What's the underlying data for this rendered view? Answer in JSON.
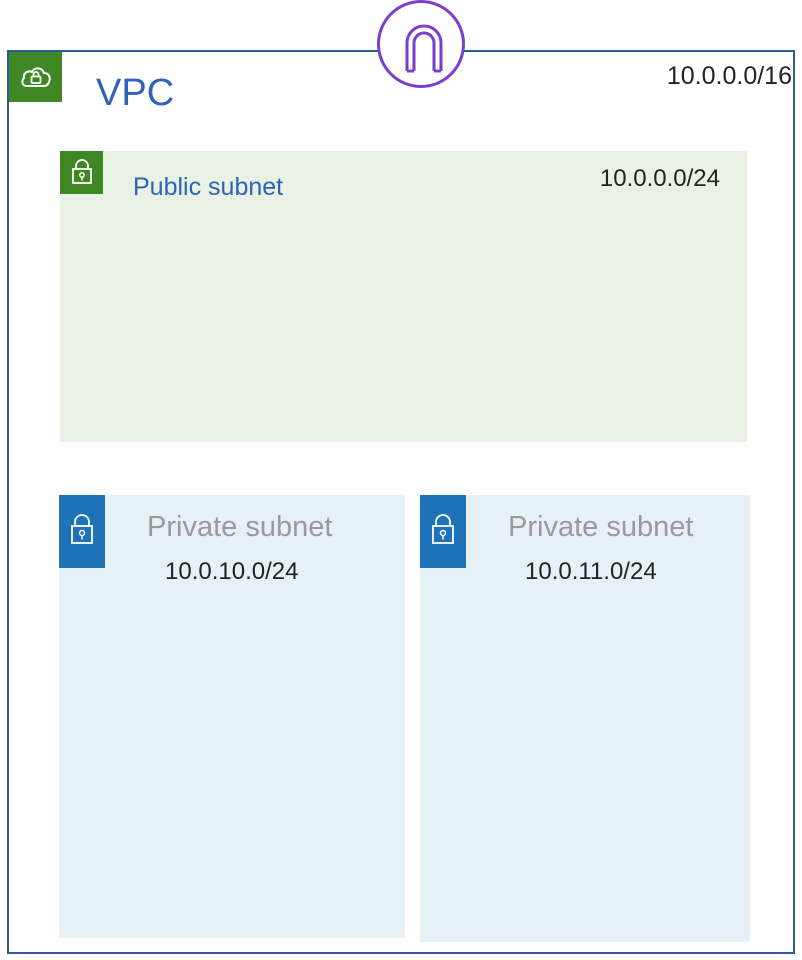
{
  "vpc": {
    "label": "VPC",
    "cidr": "10.0.0.0/16",
    "icon": "cloud-lock-icon",
    "color": "#3f8624",
    "border_color": "#2b5a93"
  },
  "gateway": {
    "icon": "internet-gateway-icon",
    "color": "#7a3ecf"
  },
  "public_subnet": {
    "label": "Public subnet",
    "cidr": "10.0.0.0/24",
    "icon": "lock-icon",
    "color": "#3f8624",
    "fill": "#e8f1e3"
  },
  "private_subnets": [
    {
      "label": "Private subnet",
      "cidr": "10.0.10.0/24",
      "icon": "lock-icon",
      "color": "#1e73b8",
      "fill": "#e5f0f7"
    },
    {
      "label": "Private subnet",
      "cidr": "10.0.11.0/24",
      "icon": "lock-icon",
      "color": "#1e73b8",
      "fill": "#e5f0f7"
    }
  ]
}
